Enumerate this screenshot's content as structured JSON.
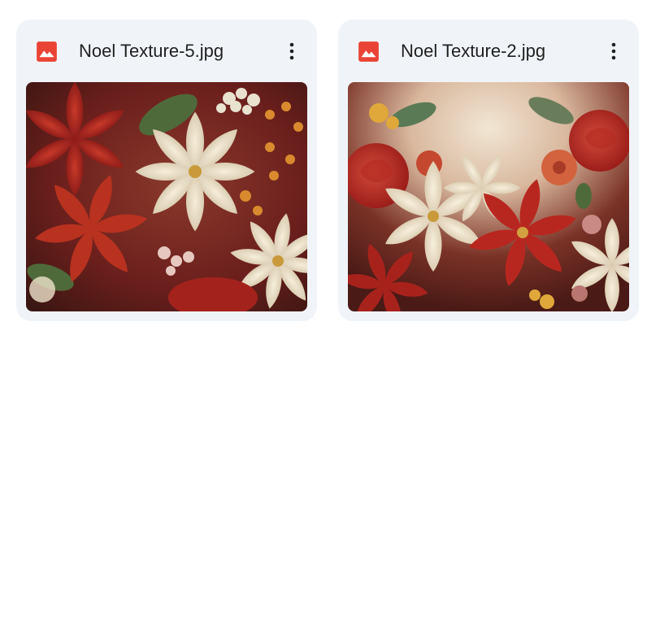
{
  "files": [
    {
      "name": "Noel Texture-5.jpg",
      "icon": "image-file-icon",
      "menu_icon": "more-vert-icon",
      "thumbnail_alt": "Painted floral texture with red and cream poinsettias"
    },
    {
      "name": "Noel Texture-2.jpg",
      "icon": "image-file-icon",
      "menu_icon": "more-vert-icon",
      "thumbnail_alt": "Painted floral texture with red roses and cream flowers"
    }
  ],
  "colors": {
    "card_background": "#f0f4f9",
    "image_icon": "#ea4335",
    "text": "#1f1f1f"
  }
}
